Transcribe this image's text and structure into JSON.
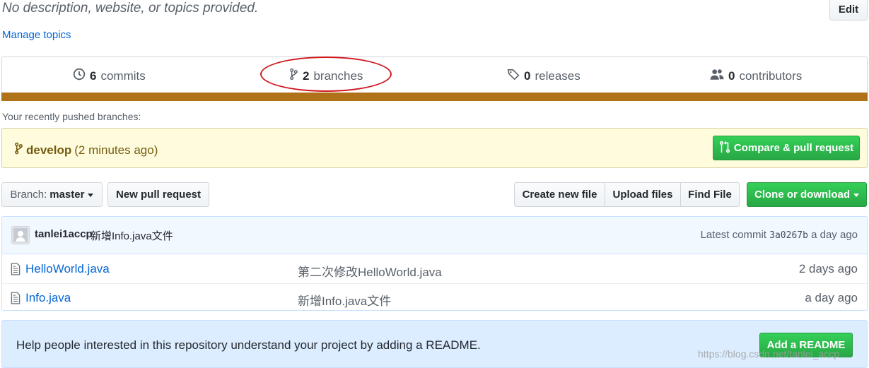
{
  "repo": {
    "description": "No description, website, or topics provided.",
    "edit_label": "Edit",
    "manage_topics_label": "Manage topics"
  },
  "summary": {
    "commits_count": "6",
    "commits_label": "commits",
    "branches_count": "2",
    "branches_label": "branches",
    "releases_count": "0",
    "releases_label": "releases",
    "contributors_count": "0",
    "contributors_label": "contributors",
    "language_color": "#b07219"
  },
  "recent": {
    "label": "Your recently pushed branches:",
    "branch_name": "develop",
    "branch_time": "(2 minutes ago)",
    "compare_label": "Compare & pull request"
  },
  "toolbar": {
    "branch_prefix": "Branch:",
    "branch_name": "master",
    "new_pr_label": "New pull request",
    "create_file_label": "Create new file",
    "upload_label": "Upload files",
    "find_file_label": "Find File",
    "clone_label": "Clone or download"
  },
  "commit": {
    "author": "tanlei1accp",
    "message": "新增Info.java文件",
    "latest_prefix": "Latest commit",
    "sha": "3a0267b",
    "age": "a day ago"
  },
  "files": [
    {
      "name": "HelloWorld.java",
      "message": "第二次修改HelloWorld.java",
      "age": "2 days ago"
    },
    {
      "name": "Info.java",
      "message": "新增Info.java文件",
      "age": "a day ago"
    }
  ],
  "readme": {
    "text": "Help people interested in this repository understand your project by adding a README.",
    "button_label": "Add a README"
  },
  "watermark": "https://blog.csdn.net/tanlei_accp"
}
